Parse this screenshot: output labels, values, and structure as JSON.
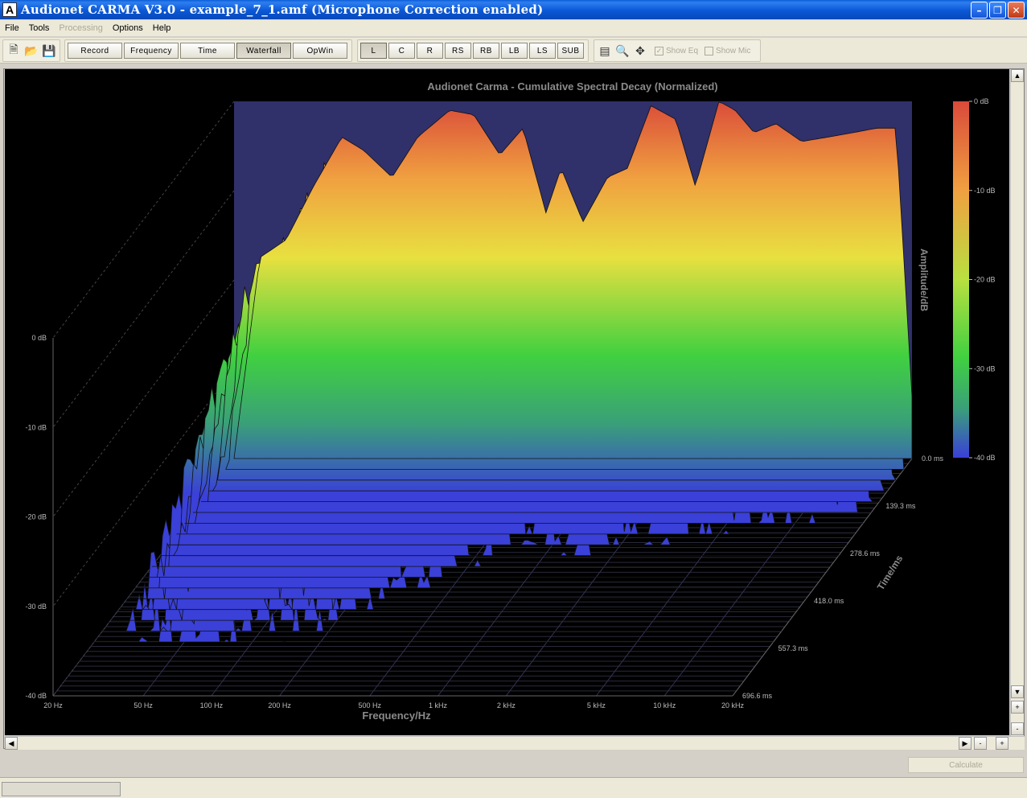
{
  "window": {
    "app_icon_letter": "A",
    "title": "Audionet CARMA V3.0 - example_7_1.amf (Microphone Correction enabled)"
  },
  "menu": [
    {
      "label": "File",
      "disabled": false
    },
    {
      "label": "Tools",
      "disabled": false
    },
    {
      "label": "Processing",
      "disabled": true
    },
    {
      "label": "Options",
      "disabled": false
    },
    {
      "label": "Help",
      "disabled": false
    }
  ],
  "toolbar": {
    "modes": [
      "Record",
      "Frequency",
      "Time",
      "Waterfall",
      "OpWin"
    ],
    "active_mode": "Waterfall",
    "channels": [
      "L",
      "C",
      "R",
      "RS",
      "RB",
      "LB",
      "LS",
      "SUB"
    ],
    "active_channel": "L",
    "show_eq_label": "Show Eq",
    "show_mic_label": "Show Mic"
  },
  "chart_data": {
    "type": "waterfall",
    "title": "Audionet Carma - Cumulative Spectral Decay (Normalized)",
    "xlabel": "Frequency/Hz",
    "ylabel": "Time/ms",
    "zlabel": "Amplitude/dB",
    "x_ticks": [
      "20 Hz",
      "50 Hz",
      "100 Hz",
      "200 Hz",
      "500 Hz",
      "1 kHz",
      "2 kHz",
      "5 kHz",
      "10 kHz",
      "20 kHz"
    ],
    "x_tick_values": [
      20,
      50,
      100,
      200,
      500,
      1000,
      2000,
      5000,
      10000,
      20000
    ],
    "xlim": [
      20,
      20000
    ],
    "x_scale": "log",
    "time_ticks": [
      "0.0 ms",
      "139.3 ms",
      "278.6 ms",
      "418.0 ms",
      "557.3 ms",
      "696.6 ms"
    ],
    "time_tick_values": [
      0,
      139.3,
      278.6,
      418.0,
      557.3,
      696.6
    ],
    "time_range_ms": [
      0,
      696.6
    ],
    "z_ticks": [
      "0 dB",
      "-10 dB",
      "-20 dB",
      "-30 dB",
      "-40 dB"
    ],
    "z_tick_values": [
      0,
      -10,
      -20,
      -30,
      -40
    ],
    "zlim": [
      -40,
      0
    ],
    "colorbar_ticks": [
      "0 dB",
      "-10 dB",
      "-20 dB",
      "-30 dB",
      "-40 dB"
    ],
    "colorbar_colors": [
      "#d94a3a",
      "#f0a040",
      "#e8e040",
      "#40d040",
      "#3aa078",
      "#3a40d8"
    ],
    "first_slice_peaks_db": [
      [
        20,
        -40
      ],
      [
        26,
        -17.5
      ],
      [
        34,
        -15.5
      ],
      [
        45,
        -9.5
      ],
      [
        60,
        -4
      ],
      [
        75,
        -5.5
      ],
      [
        100,
        -8.5
      ],
      [
        130,
        -4
      ],
      [
        180,
        -1
      ],
      [
        230,
        -1.5
      ],
      [
        300,
        -6
      ],
      [
        380,
        -3
      ],
      [
        480,
        -12.5
      ],
      [
        560,
        -7.5
      ],
      [
        700,
        -13.5
      ],
      [
        900,
        -8.5
      ],
      [
        1100,
        -7.5
      ],
      [
        1400,
        -0.5
      ],
      [
        1800,
        -2
      ],
      [
        2200,
        -9.5
      ],
      [
        2800,
        0
      ],
      [
        3300,
        -1
      ],
      [
        4000,
        -3.5
      ],
      [
        5000,
        -2.5
      ],
      [
        6500,
        -4.5
      ],
      [
        8500,
        -4
      ],
      [
        11000,
        -3.5
      ],
      [
        14000,
        -3
      ],
      [
        17000,
        -3
      ],
      [
        20000,
        -33
      ]
    ],
    "decay_floor_db": -40,
    "background": "#000000"
  },
  "status": {
    "calculate_label": "Calculate"
  }
}
